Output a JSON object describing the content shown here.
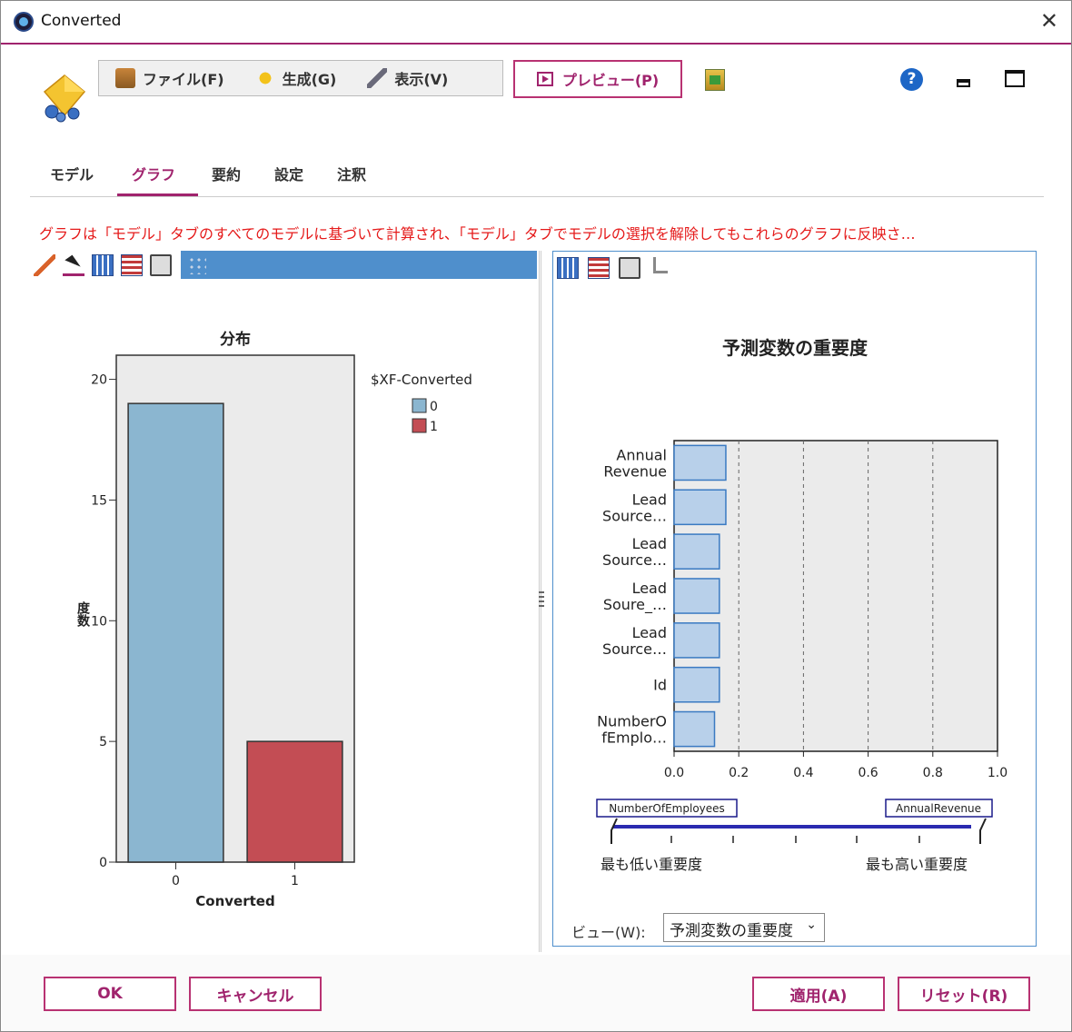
{
  "window": {
    "title": "Converted",
    "close_glyph": "✕"
  },
  "menu": {
    "file": "ファイル(F)",
    "generate": "生成(G)",
    "view": "表示(V)"
  },
  "preview_label": "プレビュー(P)",
  "help_glyph": "?",
  "tabs": [
    {
      "label": "モデル"
    },
    {
      "label": "グラフ"
    },
    {
      "label": "要約"
    },
    {
      "label": "設定"
    },
    {
      "label": "注釈"
    }
  ],
  "notice": "グラフは「モデル」タブのすべてのモデルに基づいて計算され、「モデル」タブでモデルの選択を解除してもこれらのグラフに反映さ…",
  "view_selector": {
    "label": "ビュー(W):",
    "value": "予測変数の重要度",
    "arrow": "⌄"
  },
  "buttons": {
    "ok": "OK",
    "cancel": "キャンセル",
    "apply": "適用(A)",
    "reset": "リセット(R)"
  },
  "colors": {
    "accent": "#a0236d",
    "bar0": "#8bb6d0",
    "bar1": "#c34d54",
    "importance_bar": "#b8d0ea",
    "warning": "#e51a1a"
  },
  "chart_data": [
    {
      "type": "bar",
      "title": "分布",
      "xlabel": "Converted",
      "ylabel": "度数",
      "categories": [
        "0",
        "1"
      ],
      "values": [
        19,
        5
      ],
      "ylim": [
        0,
        21
      ],
      "yticks": [
        0,
        5,
        10,
        15,
        20
      ],
      "legend": {
        "title": "$XF-Converted",
        "entries": [
          "0",
          "1"
        ],
        "position": "right"
      }
    },
    {
      "type": "bar",
      "orientation": "horizontal",
      "title": "予測変数の重要度",
      "categories": [
        [
          "Annual",
          "Revenue"
        ],
        [
          "Lead",
          "Source…"
        ],
        [
          "Lead",
          "Source…"
        ],
        [
          "Lead",
          "Soure_…"
        ],
        [
          "Lead",
          "Source…"
        ],
        [
          "Id"
        ],
        [
          "NumberO",
          "fEmplo…"
        ]
      ],
      "values": [
        0.16,
        0.16,
        0.14,
        0.14,
        0.14,
        0.14,
        0.125
      ],
      "xlim": [
        0,
        1.0
      ],
      "xticks": [
        "0.0",
        "0.2",
        "0.4",
        "0.6",
        "0.8",
        "1.0"
      ],
      "grid": "dashed vertical",
      "scale": {
        "low_variable": "NumberOfEmployees",
        "high_variable": "AnnualRevenue",
        "low_label": "最も低い重要度",
        "high_label": "最も高い重要度"
      }
    }
  ]
}
